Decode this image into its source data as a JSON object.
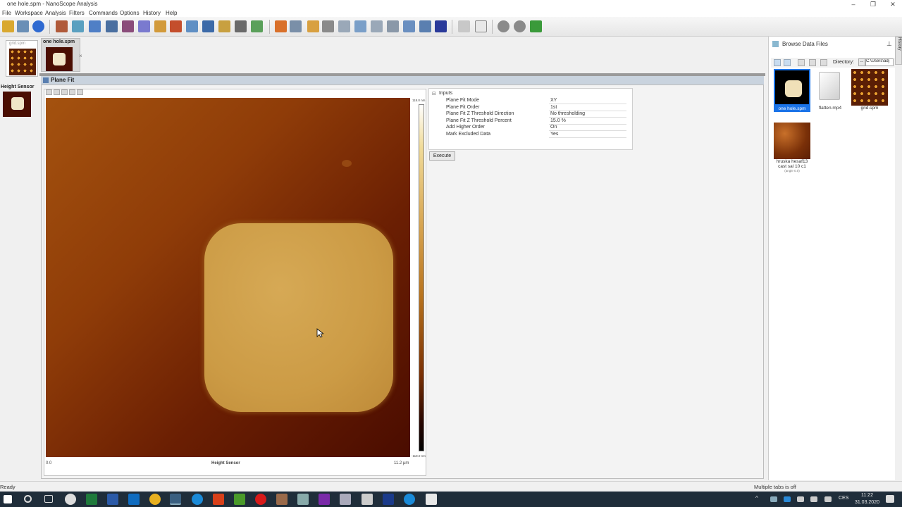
{
  "window": {
    "title": "one hole.spm - NanoScope Analysis",
    "controls": [
      "–",
      "❐",
      "✕"
    ]
  },
  "menu": [
    "File",
    "Workspace",
    "Analysis",
    "Filters",
    "Commands",
    "Options",
    "History",
    "Help"
  ],
  "thumbnails": {
    "grid_label": "grid.spm",
    "active_tab": "one hole.spm",
    "channel_label": "Height Sensor"
  },
  "panel": {
    "title": "Plane Fit",
    "inputs_header": "Inputs",
    "params": [
      {
        "label": "Plane Fit Mode",
        "value": "XY"
      },
      {
        "label": "Plane Fit Order",
        "value": "1st"
      },
      {
        "label": "Plane Fit Z Threshold Direction",
        "value": "No thresholding"
      },
      {
        "label": "Plane Fit Z Threshold Percent",
        "value": "15.0 %"
      },
      {
        "label": "Add Higher Order",
        "value": "On"
      },
      {
        "label": "Mark Excluded Data",
        "value": "Yes"
      }
    ],
    "execute_label": "Execute"
  },
  "image": {
    "x_start": "0.0",
    "x_end": "11.2 µm",
    "channel": "Height Sensor",
    "scale_top": "118.0 nm",
    "scale_bottom": "-118.0 nm"
  },
  "browse": {
    "title": "Browse Data Files",
    "directory_label": "Directory:",
    "directory_value": "C:\\Users\\adj",
    "files": [
      {
        "name": "one hole.spm",
        "selected": true
      },
      {
        "name": "flatten.mp4",
        "selected": false
      },
      {
        "name": "grid.spm",
        "selected": false
      },
      {
        "name": "hruska hesaf13 cast sal 10 c1",
        "sub": "(angle 0.0)",
        "selected": false
      }
    ],
    "history_tab": "History"
  },
  "status": {
    "left": "Ready",
    "right": "Multiple tabs is off"
  },
  "taskbar": {
    "lang": "CES",
    "time": "11:22",
    "date": "31.03.2020"
  },
  "colors": {
    "selected_file": "#1a73e8",
    "taskbar": "#1f2d3a"
  }
}
